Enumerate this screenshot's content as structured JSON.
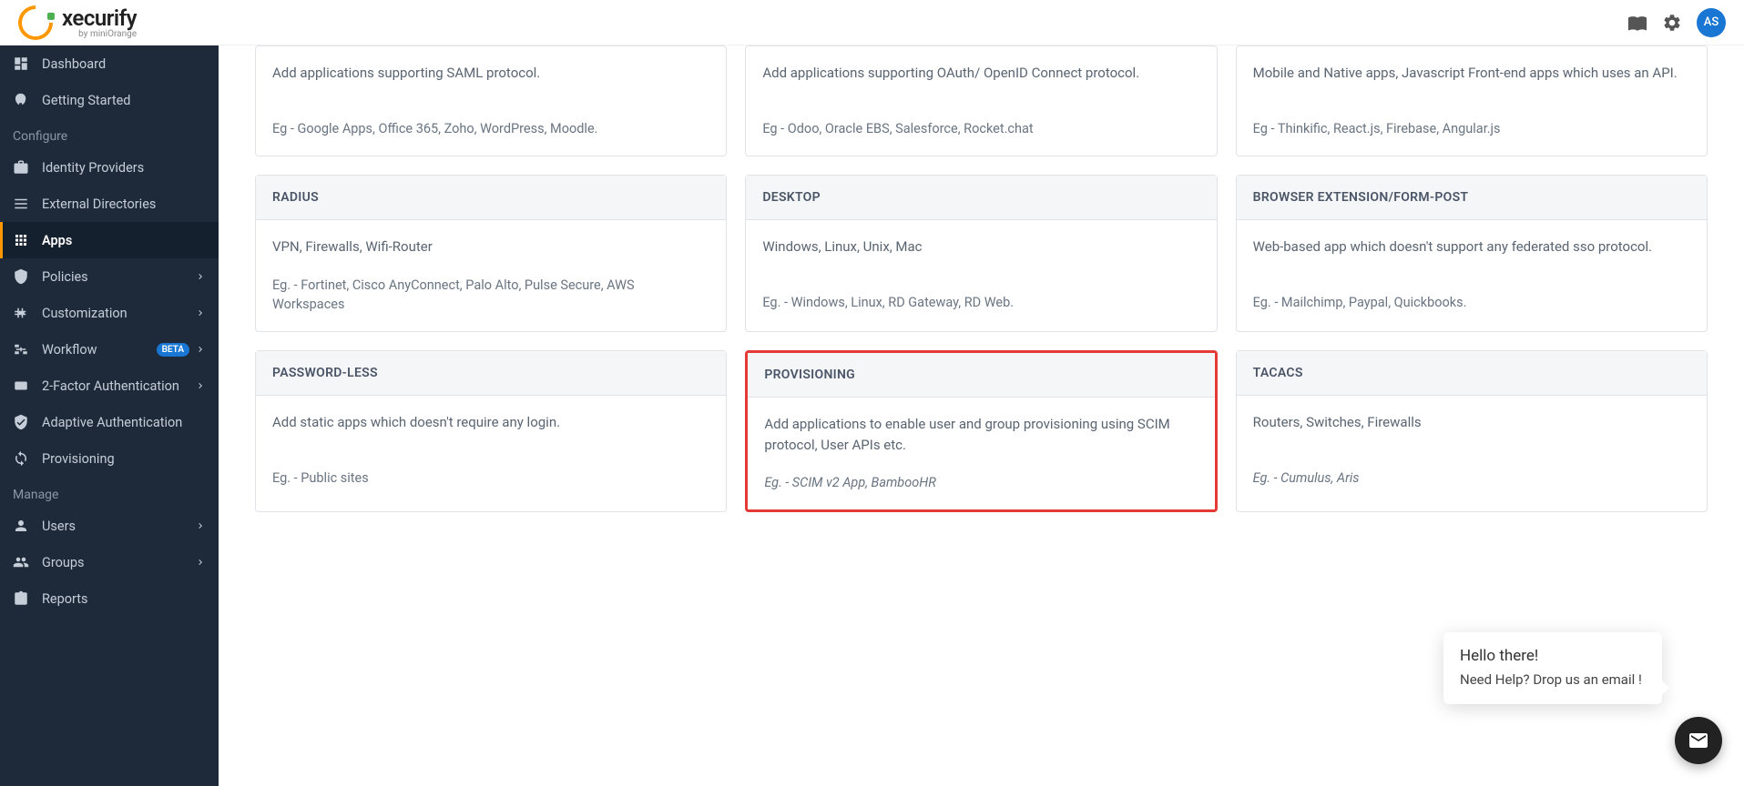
{
  "header": {
    "logo_main": "xecurify",
    "logo_sub": "by miniOrange",
    "avatar_initials": "AS"
  },
  "sidebar": {
    "items": [
      {
        "label": "Dashboard",
        "icon": "dashboard",
        "active": false,
        "expandable": false
      },
      {
        "label": "Getting Started",
        "icon": "rocket",
        "active": false,
        "expandable": false
      }
    ],
    "section_configure": "Configure",
    "configure_items": [
      {
        "label": "Identity Providers",
        "icon": "briefcase",
        "active": false,
        "expandable": false
      },
      {
        "label": "External Directories",
        "icon": "list",
        "active": false,
        "expandable": false
      },
      {
        "label": "Apps",
        "icon": "grid",
        "active": true,
        "expandable": false
      },
      {
        "label": "Policies",
        "icon": "shield-cog",
        "active": false,
        "expandable": true
      },
      {
        "label": "Customization",
        "icon": "puzzle",
        "active": false,
        "expandable": true
      },
      {
        "label": "Workflow",
        "icon": "flow",
        "active": false,
        "expandable": true,
        "badge": "BETA"
      },
      {
        "label": "2-Factor Authentication",
        "icon": "pin",
        "active": false,
        "expandable": true
      },
      {
        "label": "Adaptive Authentication",
        "icon": "shield-check",
        "active": false,
        "expandable": false
      },
      {
        "label": "Provisioning",
        "icon": "sync",
        "active": false,
        "expandable": false
      }
    ],
    "section_manage": "Manage",
    "manage_items": [
      {
        "label": "Users",
        "icon": "user",
        "active": false,
        "expandable": true
      },
      {
        "label": "Groups",
        "icon": "users",
        "active": false,
        "expandable": true
      },
      {
        "label": "Reports",
        "icon": "clipboard",
        "active": false,
        "expandable": false
      }
    ]
  },
  "cards_row1": [
    {
      "title": "",
      "desc": "Add applications supporting SAML protocol.",
      "example": "Eg - Google Apps, Office 365, Zoho, WordPress, Moodle."
    },
    {
      "title": "",
      "desc": "Add applications supporting OAuth/ OpenID Connect protocol.",
      "example": "Eg - Odoo, Oracle EBS, Salesforce, Rocket.chat"
    },
    {
      "title": "",
      "desc": "Mobile and Native apps, Javascript Front-end apps which uses an API.",
      "example": "Eg - Thinkific, React.js, Firebase, Angular.js"
    }
  ],
  "cards_row2": [
    {
      "title": "RADIUS",
      "desc": "VPN, Firewalls, Wifi-Router",
      "example": "Eg. - Fortinet, Cisco AnyConnect, Palo Alto, Pulse Secure, AWS Workspaces"
    },
    {
      "title": "DESKTOP",
      "desc": "Windows, Linux, Unix, Mac",
      "example": "Eg. - Windows, Linux, RD Gateway, RD Web."
    },
    {
      "title": "BROWSER EXTENSION/FORM-POST",
      "desc": "Web-based app which doesn't support any federated sso protocol.",
      "example": "Eg. - Mailchimp, Paypal, Quickbooks."
    }
  ],
  "cards_row3": [
    {
      "title": "PASSWORD-LESS",
      "desc": "Add static apps which doesn't require any login.",
      "example": "Eg. - Public sites"
    },
    {
      "title": "PROVISIONING",
      "desc": "Add applications to enable user and group provisioning using SCIM protocol, User APIs etc.",
      "example": "Eg. - SCIM v2 App, BambooHR",
      "highlighted": true
    },
    {
      "title": "TACACS",
      "desc": "Routers, Switches, Firewalls",
      "example": "Eg. - Cumulus, Aris"
    }
  ],
  "chat": {
    "title": "Hello there!",
    "message": "Need Help? Drop us an email !"
  }
}
